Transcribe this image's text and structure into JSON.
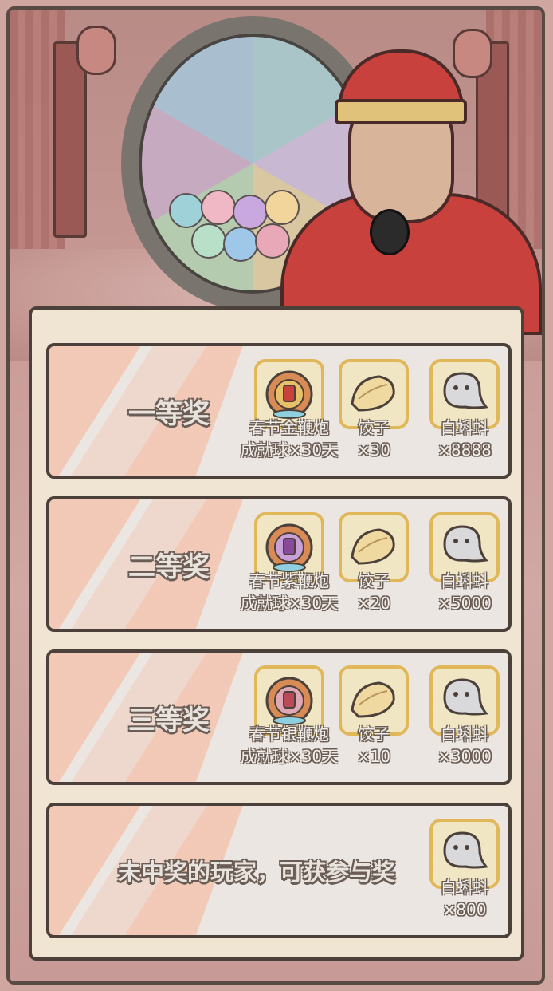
{
  "prizes": [
    {
      "title": "一等奖",
      "items": [
        {
          "icon": "firecracker-ball-gold-icon",
          "line1": "春节金鞭炮",
          "line2": "成就球×30天",
          "color": "#d98b55"
        },
        {
          "icon": "dumpling-icon",
          "line1": "饺子",
          "line2": "×30"
        },
        {
          "icon": "white-tadpole-icon",
          "line1": "白蝌蚪",
          "line2": "×8888"
        }
      ]
    },
    {
      "title": "二等奖",
      "items": [
        {
          "icon": "firecracker-ball-purple-icon",
          "line1": "春节紫鞭炮",
          "line2": "成就球×30天",
          "color": "#a06aa8"
        },
        {
          "icon": "dumpling-icon",
          "line1": "饺子",
          "line2": "×20"
        },
        {
          "icon": "white-tadpole-icon",
          "line1": "白蝌蚪",
          "line2": "×5000"
        }
      ]
    },
    {
      "title": "三等奖",
      "items": [
        {
          "icon": "firecracker-ball-silver-icon",
          "line1": "春节银鞭炮",
          "line2": "成就球×30天",
          "color": "#b86a78"
        },
        {
          "icon": "dumpling-icon",
          "line1": "饺子",
          "line2": "×10"
        },
        {
          "icon": "white-tadpole-icon",
          "line1": "白蝌蚪",
          "line2": "×3000"
        }
      ]
    },
    {
      "title": "未中奖的玩家，可获参与奖",
      "items": [
        {
          "icon": "white-tadpole-icon",
          "line1": "白蝌蚪",
          "line2": "×800"
        }
      ]
    }
  ],
  "colors": {
    "card_border": "#4b403a",
    "icon_border": "#e0b85a",
    "stripe": "#f5baa0",
    "host_red": "#c9413c"
  }
}
